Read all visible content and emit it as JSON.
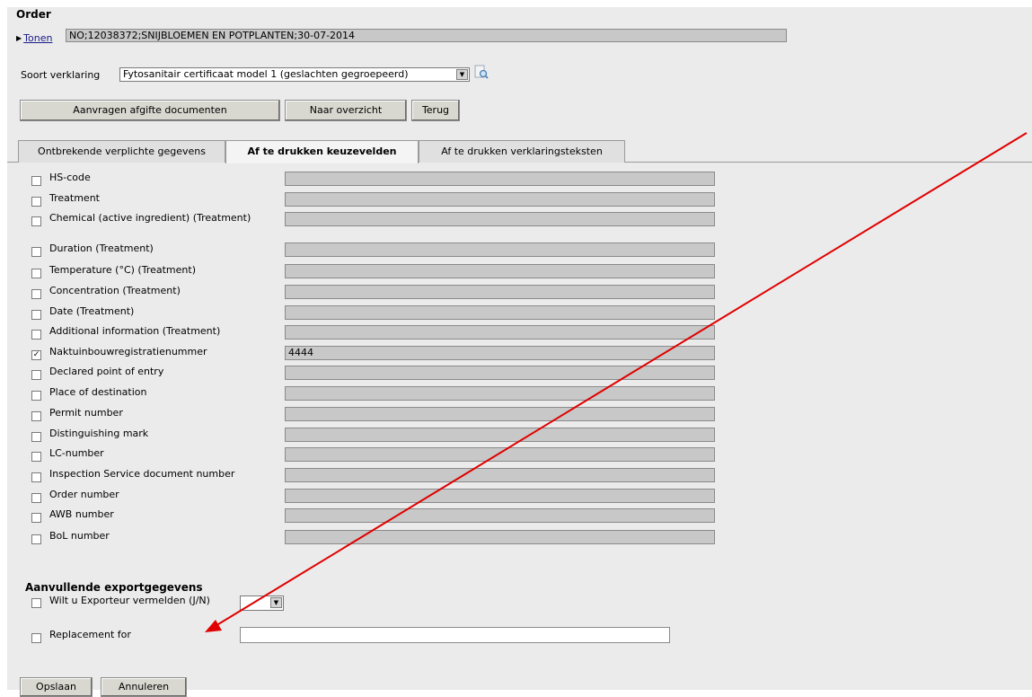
{
  "header": {
    "title": "Order",
    "tonen_link": "Tonen",
    "order_summary": "NO;12038372;SNIJBLOEMEN EN POTPLANTEN;30-07-2014"
  },
  "soort": {
    "label": "Soort verklaring",
    "selected": "Fytosanitair certificaat model 1 (geslachten gegroepeerd)"
  },
  "toolbar": {
    "aanvragen_label": "Aanvragen afgifte documenten",
    "overzicht_label": "Naar overzicht",
    "terug_label": "Terug"
  },
  "tabs": [
    {
      "label": "Ontbrekende verplichte gegevens",
      "active": false
    },
    {
      "label": "Af te drukken keuzevelden",
      "active": true
    },
    {
      "label": "Af te drukken verklaringsteksten",
      "active": false
    }
  ],
  "rows": [
    {
      "label": "HS-code",
      "checked": false,
      "value": ""
    },
    {
      "label": "Treatment",
      "checked": false,
      "value": ""
    },
    {
      "label": "Chemical (active ingredient) (Treatment)",
      "checked": false,
      "value": ""
    },
    {
      "label": "Duration (Treatment)",
      "checked": false,
      "value": ""
    },
    {
      "label": "Temperature (°C) (Treatment)",
      "checked": false,
      "value": ""
    },
    {
      "label": "Concentration (Treatment)",
      "checked": false,
      "value": ""
    },
    {
      "label": "Date (Treatment)",
      "checked": false,
      "value": ""
    },
    {
      "label": "Additional information (Treatment)",
      "checked": false,
      "value": ""
    },
    {
      "label": "Naktuinbouwregistratienummer",
      "checked": true,
      "value": "4444"
    },
    {
      "label": "Declared point of entry",
      "checked": false,
      "value": ""
    },
    {
      "label": "Place of destination",
      "checked": false,
      "value": ""
    },
    {
      "label": "Permit number",
      "checked": false,
      "value": ""
    },
    {
      "label": "Distinguishing mark",
      "checked": false,
      "value": ""
    },
    {
      "label": "LC-number",
      "checked": false,
      "value": ""
    },
    {
      "label": "Inspection Service document number",
      "checked": false,
      "value": ""
    },
    {
      "label": "Order number",
      "checked": false,
      "value": ""
    },
    {
      "label": "AWB number",
      "checked": false,
      "value": ""
    },
    {
      "label": "BoL number",
      "checked": false,
      "value": ""
    }
  ],
  "export": {
    "heading": "Aanvullende exportgegevens",
    "exporteur_label": "Wilt u Exporteur vermelden (J/N)",
    "exporteur_value": "",
    "replacement_label": "Replacement for",
    "replacement_value": ""
  },
  "footer": {
    "opslaan_label": "Opslaan",
    "annuleren_label": "Annuleren"
  },
  "annotation": {
    "arrow_color": "#e00000"
  }
}
